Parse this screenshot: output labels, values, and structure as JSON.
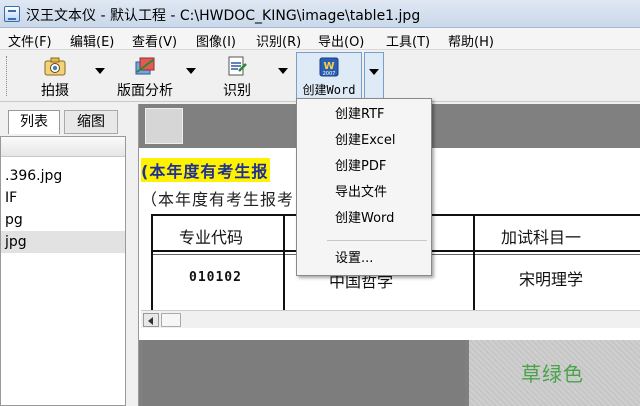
{
  "window": {
    "title": "汉王文本仪 - 默认工程 - C:\\HWDOC_KING\\image\\table1.jpg"
  },
  "menu": [
    {
      "label": "文件(F)"
    },
    {
      "label": "编辑(E)"
    },
    {
      "label": "查看(V)"
    },
    {
      "label": "图像(I)"
    },
    {
      "label": "识别(R)"
    },
    {
      "label": "导出(O)"
    },
    {
      "label": "工具(T)"
    },
    {
      "label": "帮助(H)"
    }
  ],
  "toolbar": {
    "capture_label": "拍摄",
    "layout_label": "版面分析",
    "recognize_label": "识别",
    "word_label": "创建Word",
    "word_icon_text": "W 2007"
  },
  "left_panel": {
    "tabs": [
      "列表",
      "缩图"
    ],
    "files": [
      ".396.jpg",
      "IF",
      "pg",
      "jpg"
    ]
  },
  "document": {
    "line1": "(本年度有考生报",
    "line2": "（本年度有考生报考",
    "table": {
      "header": [
        "专业代码",
        "加试科目一"
      ],
      "row": [
        "010102",
        "中国哲学",
        "宋明理学"
      ]
    },
    "color_label": "草绿色"
  },
  "dropdown": {
    "items": [
      "创建RTF",
      "创建Excel",
      "创建PDF",
      "导出文件",
      "创建Word"
    ],
    "settings": "设置..."
  },
  "colors": {
    "highlight": "#fff200",
    "heading_text": "#1f2f95",
    "green_label": "#4aa34a"
  }
}
